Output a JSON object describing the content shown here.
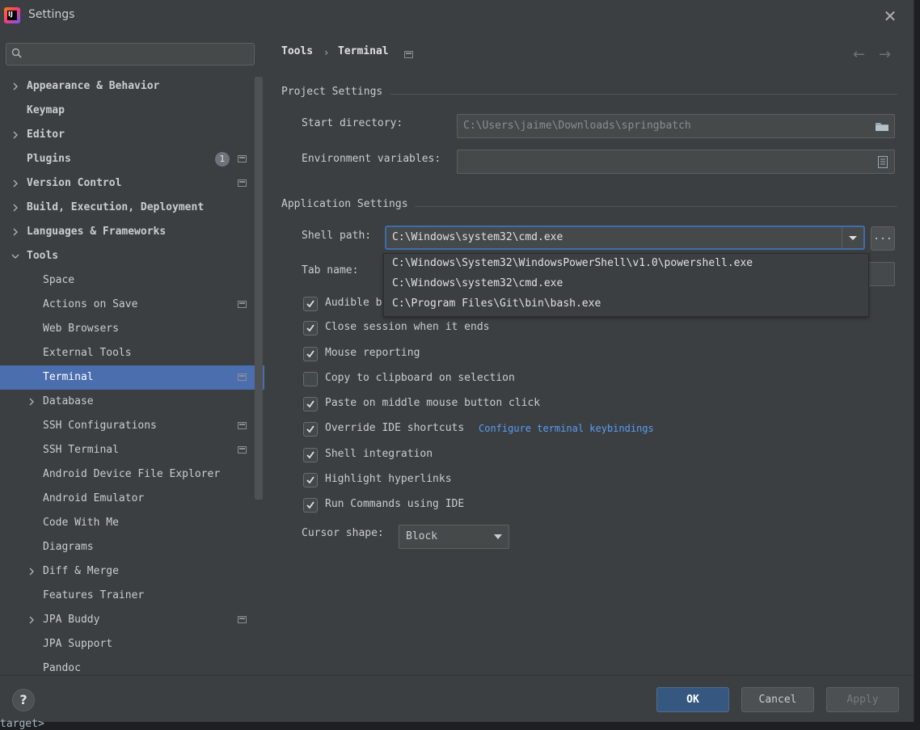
{
  "window": {
    "title": "Settings"
  },
  "search": {
    "placeholder": ""
  },
  "sidebar": {
    "items": [
      {
        "label": "Appearance & Behavior",
        "expandable": true
      },
      {
        "label": "Keymap"
      },
      {
        "label": "Editor",
        "expandable": true
      },
      {
        "label": "Plugins",
        "badge": "1"
      },
      {
        "label": "Version Control",
        "expandable": true
      },
      {
        "label": "Build, Execution, Deployment",
        "expandable": true
      },
      {
        "label": "Languages & Frameworks",
        "expandable": true
      },
      {
        "label": "Tools",
        "expanded": true
      },
      {
        "label": "Space"
      },
      {
        "label": "Actions on Save"
      },
      {
        "label": "Web Browsers"
      },
      {
        "label": "External Tools"
      },
      {
        "label": "Terminal",
        "selected": true
      },
      {
        "label": "Database",
        "expandable": true
      },
      {
        "label": "SSH Configurations"
      },
      {
        "label": "SSH Terminal"
      },
      {
        "label": "Android Device File Explorer"
      },
      {
        "label": "Android Emulator"
      },
      {
        "label": "Code With Me"
      },
      {
        "label": "Diagrams"
      },
      {
        "label": "Diff & Merge",
        "expandable": true
      },
      {
        "label": "Features Trainer"
      },
      {
        "label": "JPA Buddy",
        "expandable": true
      },
      {
        "label": "JPA Support"
      },
      {
        "label": "Pandoc"
      }
    ]
  },
  "breadcrumb": {
    "parent": "Tools",
    "separator": "›",
    "current": "Terminal"
  },
  "project_settings": {
    "title": "Project Settings",
    "start_directory_label": "Start directory:",
    "start_directory_value": "C:\\Users\\jaime\\Downloads\\springbatch",
    "env_vars_label": "Environment variables:",
    "env_vars_value": ""
  },
  "app_settings": {
    "title": "Application Settings",
    "shell_path_label": "Shell path:",
    "shell_path_value": "C:\\Windows\\system32\\cmd.exe",
    "shell_options": [
      "C:\\Windows\\System32\\WindowsPowerShell\\v1.0\\powershell.exe",
      "C:\\Windows\\system32\\cmd.exe",
      "C:\\Program Files\\Git\\bin\\bash.exe"
    ],
    "dots_label": "...",
    "tab_name_label": "Tab name:",
    "checkboxes": [
      {
        "label": "Audible b",
        "checked": true
      },
      {
        "label": "Close session when it ends",
        "checked": true
      },
      {
        "label": "Mouse reporting",
        "checked": true
      },
      {
        "label": "Copy to clipboard on selection",
        "checked": false
      },
      {
        "label": "Paste on middle mouse button click",
        "checked": true
      },
      {
        "label": "Override IDE shortcuts",
        "checked": true
      },
      {
        "label": "Shell integration",
        "checked": true
      },
      {
        "label": "Highlight hyperlinks",
        "checked": true
      },
      {
        "label": "Run Commands using IDE",
        "checked": true
      }
    ],
    "keybindings_link": "Configure terminal keybindings",
    "cursor_shape_label": "Cursor shape:",
    "cursor_shape_value": "Block"
  },
  "buttons": {
    "help": "?",
    "ok": "OK",
    "cancel": "Cancel",
    "apply": "Apply"
  },
  "terminal_fragment": "target>",
  "colors": {
    "accent": "#4b6eaf",
    "link": "#589df6",
    "ok_button": "#365880",
    "background": "#3c3f41"
  }
}
